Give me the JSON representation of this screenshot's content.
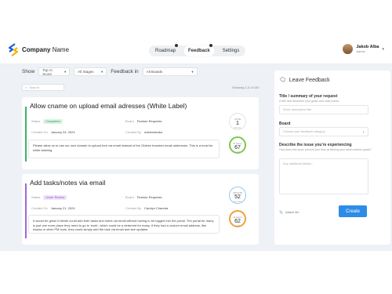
{
  "header": {
    "company_bold": "Company",
    "company_rest": "Name",
    "nav": [
      {
        "label": "Roadmap"
      },
      {
        "label": "Feedback"
      },
      {
        "label": "Settings"
      }
    ],
    "user": {
      "name": "Jakob Alba",
      "role": "Admin"
    }
  },
  "filters": {
    "show_label": "Show",
    "sort": "Top AI Score",
    "stages": "All Stages",
    "feedback_in_label": "Feedback in",
    "boards": "All Boards"
  },
  "list": {
    "search_placeholder": "Search",
    "showing": "Showing 1-5 of 100",
    "cards": [
      {
        "title": "Allow cname on upload email adresses (White Label)",
        "status_label": "Status",
        "status": "Completed",
        "board_label": "Board",
        "board": "Feature Requests",
        "created_on_label": "Created On",
        "created_on": "January 24, 2024",
        "created_by_label": "Created By",
        "created_by": "Administrator",
        "description": "Please allow us to use our own domain to upload free via email instead of the Globee branded email addresses. This is a must for white labeling.",
        "votes_label": "VOTE",
        "votes": "1",
        "votes_sub": "Upvote",
        "ai_label": "AI Score",
        "ai_score": "67",
        "ai_max": "/ 100",
        "accent": "#3bb36a",
        "status_bg": "#daf3e2",
        "status_color": "#2f9a58",
        "ring_color": "#7bc94a"
      },
      {
        "title": "Add tasks/notes via email",
        "status_label": "Status",
        "status": "Under Review",
        "board_label": "Board",
        "board": "Feature Requests",
        "created_on_label": "Created On",
        "created_on": "January 21, 2024",
        "created_by_label": "Created By",
        "created_by": "Carolyn Chandra",
        "description": "It would be great if clients could add both tasks and notes via email without having to be logged into the portal. The portal for many is just one more place they need to go to 'work', which could be a deterrent for many. If they had a custom email address, like Asana or other PM tools, they could simply add the task via email and see updates.",
        "votes_label": "UPVOTE",
        "votes": "52",
        "votes_sub": "Upvotes",
        "ai_label": "AI Score",
        "ai_score": "62",
        "ai_max": "/ 100",
        "accent": "#9b6ad6",
        "status_bg": "#efe3fb",
        "status_color": "#8a53c9",
        "ring_color": "#f0a13a"
      }
    ]
  },
  "panel": {
    "title": "Leave Feedback",
    "title_label": "Title / summary of your request",
    "title_help": "A title that describes your goals and main points.",
    "title_placeholder": "Short, descriptive title",
    "board_label": "Board",
    "board_placeholder": "Choose your feedback category",
    "issue_label": "Describe the issue you're experiencing",
    "issue_help": "How does this issue prevent you from achieving your ideal solution goals?",
    "issue_placeholder": "Any additional details...",
    "attach_label": "Attach file",
    "create_label": "Create"
  }
}
